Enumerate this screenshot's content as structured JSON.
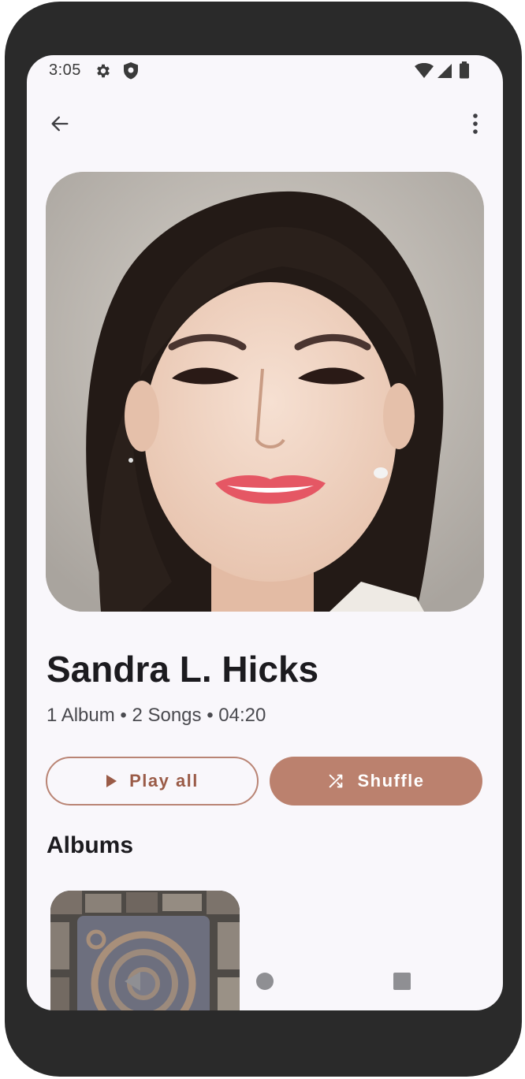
{
  "status_bar": {
    "time": "3:05",
    "left_icons": [
      "settings-icon",
      "shield-icon"
    ],
    "right_icons": [
      "wifi-icon",
      "signal-icon",
      "battery-icon"
    ]
  },
  "app_bar": {
    "back_icon": "arrow-back-icon",
    "menu_icon": "more-vert-icon"
  },
  "artist": {
    "name": "Sandra L. Hicks",
    "meta": "1 Album • 2 Songs • 04:20"
  },
  "actions": {
    "play_all_label": "Play all",
    "play_icon": "play-icon",
    "shuffle_label": "Shuffle",
    "shuffle_icon": "shuffle-icon"
  },
  "albums_section": {
    "title": "Albums",
    "items": [
      {
        "cover": "album-cover"
      }
    ]
  },
  "nav_bar": {
    "buttons": [
      "back-triangle-icon",
      "home-circle-icon",
      "recents-square-icon"
    ]
  },
  "colors": {
    "accent": "#bb816e",
    "accent_text": "#9a5b47",
    "background": "#f9f7fb",
    "frame": "#2a2a2a",
    "text_primary": "#1c1b1f",
    "text_secondary": "#4a4a4f"
  }
}
